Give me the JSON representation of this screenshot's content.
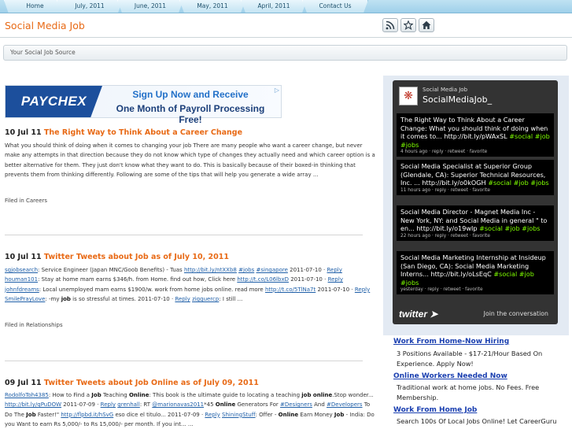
{
  "nav": [
    "Home",
    "July, 2011",
    "June, 2011",
    "May, 2011",
    "April, 2011",
    "Contact Us"
  ],
  "header": {
    "title": "Social Media Job",
    "tagline": "Your Social Job Source",
    "icons": [
      "rss-icon",
      "star-icon",
      "home-icon"
    ]
  },
  "ad": {
    "logo": "PAYCHEX",
    "line1": "Sign Up Now and Receive",
    "line2": "One Month of Payroll Processing Free!",
    "choice": "▷"
  },
  "posts": [
    {
      "date": "10 Jul 11",
      "title": "The Right Way to Think About a Career Change",
      "body": "What you should think of doing when it comes to changing your job There are many people who want a career change, but never make any attempts in that direction because they do not know which type of changes they actually need and which career option is a better alternative for them. They just don't know what they want to do. This is basically because of their boxed-in thinking that prevents them from thinking differently. Following are some of the tips that will help you generate a wide array ...",
      "filed": "Filed in Careers"
    },
    {
      "date": "10 Jul 11",
      "title": "Twitter Tweets about Job as of July 10, 2011",
      "body": [
        {
          "t": "sgjobsearch",
          "l": true
        },
        {
          "t": ": Service Engineer (Japan MNC/Goob Benefits) - Tuas "
        },
        {
          "t": "http://bit.ly/ntXXb8",
          "l": true
        },
        {
          "t": " "
        },
        {
          "t": "#jobs",
          "l": true
        },
        {
          "t": " "
        },
        {
          "t": "#singapore",
          "l": true
        },
        {
          "t": " 2011-07-10 · "
        },
        {
          "t": "Reply",
          "l": true
        },
        {
          "t": " "
        },
        {
          "t": "houman101",
          "l": true
        },
        {
          "t": ": Stay at home mam earns $346/h. from Home. find out how, Click here "
        },
        {
          "t": "http://t.co/L06lbxD",
          "l": true
        },
        {
          "t": " 2011-07-10 · "
        },
        {
          "t": "Reply",
          "l": true
        },
        {
          "t": " "
        },
        {
          "t": "johnfdreams",
          "l": true
        },
        {
          "t": ": Local unemployed mam earns $1900/w. work from home jobs online. read more "
        },
        {
          "t": "http://t.co/5TlNa7t",
          "l": true
        },
        {
          "t": " 2011-07-10 · "
        },
        {
          "t": "Reply",
          "l": true
        },
        {
          "t": " "
        },
        {
          "t": "SmilePrayLove",
          "l": true
        },
        {
          "t": ": -my "
        },
        {
          "t": "job",
          "b": true
        },
        {
          "t": " is so stressful at times. 2011-07-10 · "
        },
        {
          "t": "Reply",
          "l": true
        },
        {
          "t": " "
        },
        {
          "t": "zigguercp",
          "l": true
        },
        {
          "t": ": I still ..."
        }
      ],
      "filed": "Filed in Relationships"
    },
    {
      "date": "09 Jul 11",
      "title": "Twitter Tweets about Job Online as of July 09, 2011",
      "body": [
        {
          "t": "RodolfoToh4385",
          "l": true
        },
        {
          "t": ": How to Find a "
        },
        {
          "t": "Job",
          "b": true
        },
        {
          "t": " Teaching "
        },
        {
          "t": "Online",
          "b": true
        },
        {
          "t": ": This book is the ultimate guide to locating a teaching "
        },
        {
          "t": "job online",
          "b": true
        },
        {
          "t": ".Stop wonder... "
        },
        {
          "t": "http://bit.ly/qPuDOW",
          "l": true
        },
        {
          "t": " 2011-07-09 · "
        },
        {
          "t": "Reply",
          "l": true
        },
        {
          "t": " "
        },
        {
          "t": "grenhall",
          "l": true
        },
        {
          "t": ": RT "
        },
        {
          "t": "@marionavas2011",
          "l": true
        },
        {
          "t": "*45 "
        },
        {
          "t": "Online",
          "b": true
        },
        {
          "t": " Generators For "
        },
        {
          "t": "#Designers",
          "l": true
        },
        {
          "t": " And "
        },
        {
          "t": "#Developers",
          "l": true
        },
        {
          "t": " To Do The "
        },
        {
          "t": "Job",
          "b": true
        },
        {
          "t": " Faster!\" "
        },
        {
          "t": "http://flpbd.it/hSvG",
          "l": true
        },
        {
          "t": " eso dice el titulo... 2011-07-09 · "
        },
        {
          "t": "Reply",
          "l": true
        },
        {
          "t": " "
        },
        {
          "t": "ShiningStuff",
          "l": true
        },
        {
          "t": ": Offer - "
        },
        {
          "t": "Online",
          "b": true
        },
        {
          "t": " Earn Money "
        },
        {
          "t": "Job",
          "b": true
        },
        {
          "t": " - India: Do you Want to earn Rs 5,000/- to Rs 15,000/- per month. If you int... ..."
        }
      ]
    }
  ],
  "widget": {
    "name": "Social Media Job",
    "handle": "SocialMediaJob_",
    "tweets": [
      {
        "text": "The Right Way to Think About a Career Change: What you should think of doing when it comes to... http://bit.ly/pWAxSL ",
        "tags": "#social #job #jobs",
        "meta": "4 hours ago · reply · retweet · favorite"
      },
      {
        "text": "Social Media Specialist at Superior Group (Glendale, CA): Superior Technical Resources, Inc. ... http://bit.ly/o0kOGH ",
        "tags": "#social #job #jobs",
        "meta": "11 hours ago · reply · retweet · favorite"
      },
      {
        "text": "Social Media Director - Magnet Media Inc - New York, NY: and Social Media in general \" to en... http://bit.ly/o19wIp ",
        "tags": "#social #job #jobs",
        "meta": "22 hours ago · reply · retweet · favorite"
      },
      {
        "text": "Social Media Marketing Internship at Insideup (San Diego, CA): Social Media Marketing Interns... http://bit.ly/oLsEqC ",
        "tags": "#social #job #jobs",
        "meta": "yesterday · reply · retweet · favorite"
      }
    ],
    "logo": "twitter",
    "join": "Join the conversation"
  },
  "sidebar_links": [
    {
      "title": "Work From Home-Now Hiring",
      "desc": "3 Positions Available - $17-21/Hour Based On Experience. Apply Now!"
    },
    {
      "title": "Online Workers Needed Now",
      "desc": "Traditional work at home jobs. No Fees. Free Membership."
    },
    {
      "title": "Work From Home Job",
      "desc": "Search 100s Of Local Jobs Online! Let CareerGuru"
    }
  ]
}
